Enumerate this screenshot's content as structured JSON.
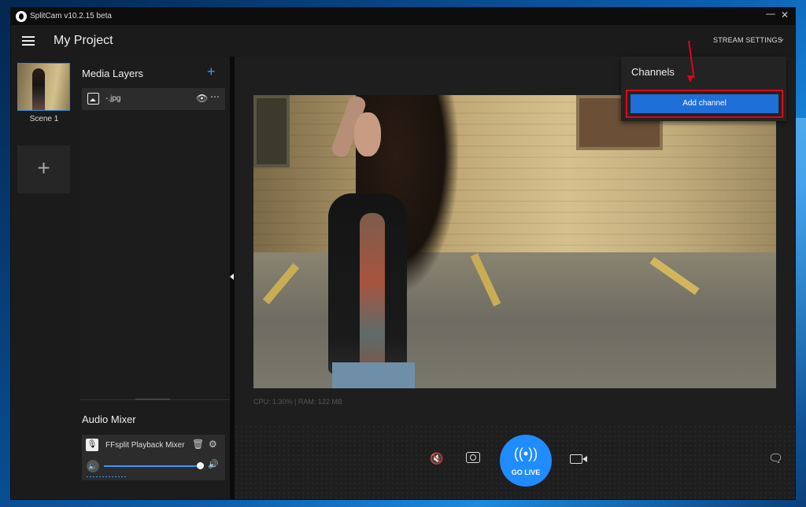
{
  "window": {
    "title": "SplitCam v10.2.15 beta",
    "minimize_glyph": "—",
    "close_glyph": "✕"
  },
  "header": {
    "project_title": "My Project",
    "stream_settings_label": "STREAM SETTINGS",
    "chevron_glyph": "⌄"
  },
  "scenes": {
    "items": [
      {
        "label": "Scene 1"
      }
    ],
    "add_glyph": "+"
  },
  "media_layers": {
    "title": "Media Layers",
    "add_glyph": "+",
    "items": [
      {
        "name": "-.jpg",
        "visibility_glyph": "👁",
        "more_glyph": "⋯"
      }
    ]
  },
  "audio_mixer": {
    "title": "Audio Mixer",
    "items": [
      {
        "name": "FFsplit Playback Mixer",
        "mic_glyph": "🎙",
        "trash_glyph": "🗑",
        "gear_glyph": "⚙",
        "mute_glyph": "🔈",
        "speaker_glyph": "🔊",
        "volume": 1.0
      }
    ]
  },
  "stage": {
    "stats": "CPU: 1.30% | RAM: 122 MB",
    "mute_glyph": "🔇",
    "go_live_icon_glyph": "((•))",
    "go_live_label": "GO LIVE",
    "chat_glyph": "🗨"
  },
  "channels": {
    "title": "Channels",
    "add_channel_label": "Add channel"
  },
  "colors": {
    "accent": "#1f8cff",
    "button_blue": "#1f6fd9",
    "highlight_red": "#e4001a",
    "window_bg": "#1c1c1c"
  }
}
